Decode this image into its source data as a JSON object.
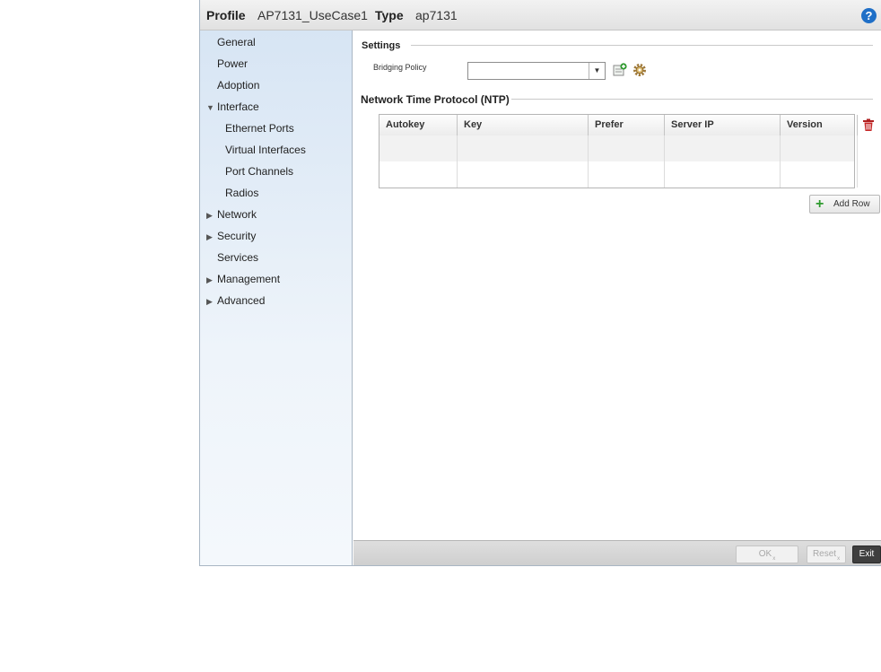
{
  "header": {
    "profile_label": "Profile",
    "profile_value": "AP7131_UseCase1",
    "type_label": "Type",
    "type_value": "ap7131",
    "help_icon": "help-icon"
  },
  "sidebar": {
    "items": [
      {
        "label": "General"
      },
      {
        "label": "Power"
      },
      {
        "label": "Adoption"
      },
      {
        "label": "Interface",
        "expanded": true
      },
      {
        "label": "Ethernet Ports"
      },
      {
        "label": "Virtual Interfaces"
      },
      {
        "label": "Port Channels"
      },
      {
        "label": "Radios"
      },
      {
        "label": "Network",
        "expanded": false
      },
      {
        "label": "Security",
        "expanded": false
      },
      {
        "label": "Services"
      },
      {
        "label": "Management",
        "expanded": false
      },
      {
        "label": "Advanced",
        "expanded": false
      }
    ]
  },
  "settings": {
    "title": "Settings",
    "bridging_policy_label": "Bridging Policy",
    "bridging_policy_value": ""
  },
  "ntp": {
    "title": "Network Time Protocol (NTP)",
    "columns": [
      "Autokey",
      "Key",
      "Prefer",
      "Server IP",
      "Version"
    ],
    "rows": [
      [
        "",
        "",
        "",
        "",
        ""
      ],
      [
        "",
        "",
        "",
        "",
        ""
      ]
    ],
    "add_row_label": "Add Row"
  },
  "footer": {
    "ok_label": "OK",
    "reset_label": "Reset",
    "exit_label": "Exit"
  },
  "colors": {
    "help": "#1f6fc7",
    "delete": "#b02020",
    "add": "#2e9a2e",
    "exit_bg": "#3f3f3f"
  }
}
